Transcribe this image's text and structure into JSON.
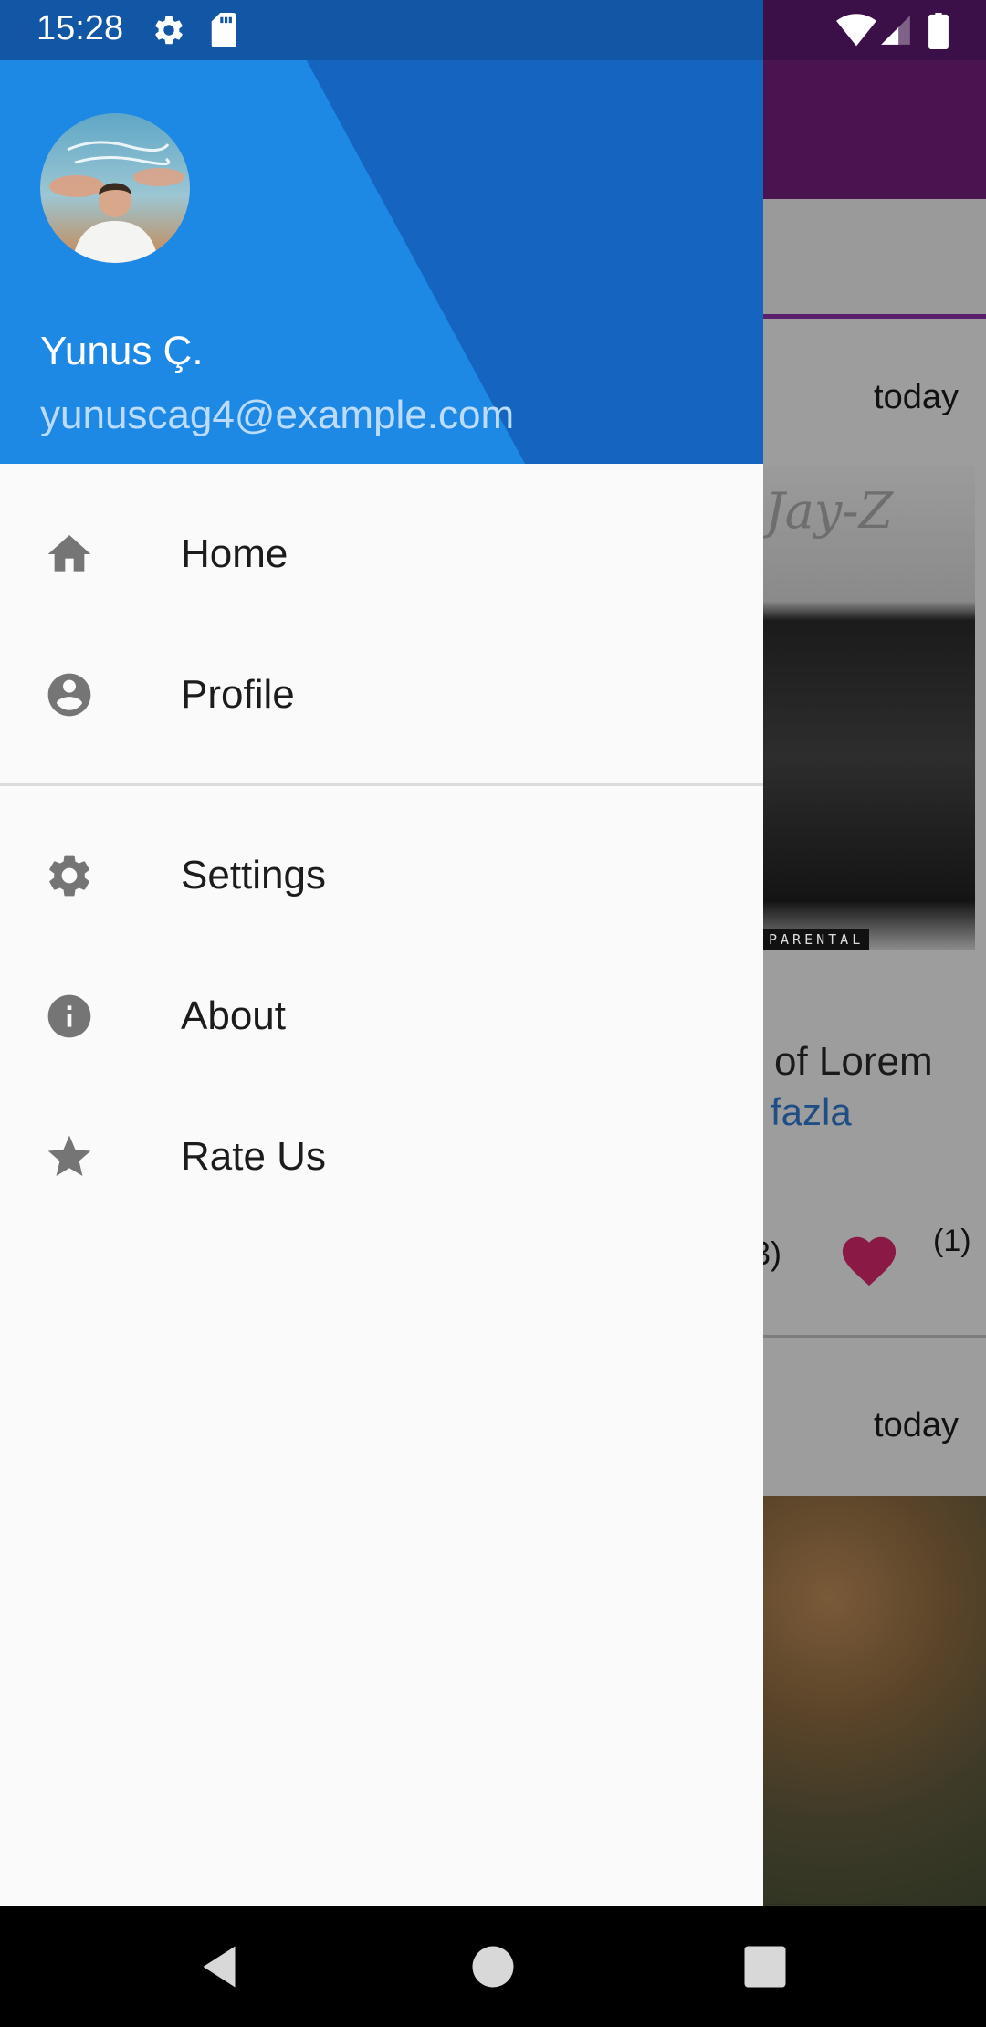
{
  "status_bar": {
    "time": "15:28",
    "icons": [
      "gear-icon",
      "sd-card-icon",
      "wifi-icon",
      "signal-icon",
      "battery-icon"
    ]
  },
  "background": {
    "toolbar_color": "#4a1450",
    "cards": [
      {
        "date": "today",
        "image_text": "Jay-Z",
        "image_footer": "PARENTAL",
        "title_fragment": "of Lorem",
        "link_fragment": "fazla",
        "left_count": "3)",
        "like_count": "(1)"
      },
      {
        "date": "today"
      }
    ]
  },
  "drawer": {
    "header": {
      "name": "Yunus Ç.",
      "email": "yunuscag4@example.com",
      "colors": {
        "primary": "#1e88e5",
        "secondary": "#1565c0"
      }
    },
    "primary_items": [
      {
        "label": "Home",
        "icon": "home-icon"
      },
      {
        "label": "Profile",
        "icon": "account-circle-icon"
      }
    ],
    "secondary_items": [
      {
        "label": "Settings",
        "icon": "settings-icon"
      },
      {
        "label": "About",
        "icon": "info-icon"
      },
      {
        "label": "Rate Us",
        "icon": "star-icon"
      }
    ]
  },
  "nav_bar": {
    "buttons": [
      "back-icon",
      "home-circle-icon",
      "recents-icon"
    ]
  }
}
